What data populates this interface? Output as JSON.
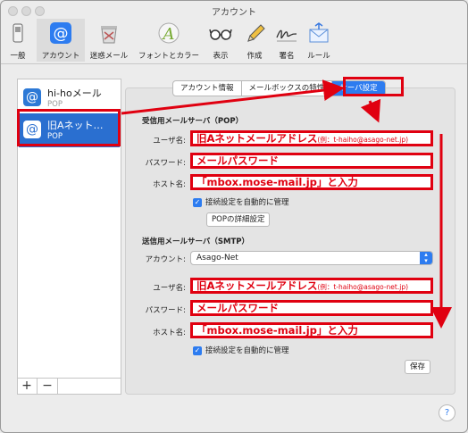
{
  "window": {
    "title": "アカウント"
  },
  "toolbar": {
    "items": [
      {
        "label": "一般",
        "icon": "switch-icon"
      },
      {
        "label": "アカウント",
        "icon": "at-sign-icon"
      },
      {
        "label": "迷惑メール",
        "icon": "junk-bin-icon"
      },
      {
        "label": "フォントとカラー",
        "icon": "font-color-icon"
      },
      {
        "label": "表示",
        "icon": "glasses-icon"
      },
      {
        "label": "作成",
        "icon": "pencil-icon"
      },
      {
        "label": "署名",
        "icon": "signature-icon"
      },
      {
        "label": "ルール",
        "icon": "envelope-rules-icon"
      }
    ],
    "selected": "アカウント"
  },
  "sidebar": {
    "accounts": [
      {
        "name": "hi-hoメール",
        "type": "POP"
      },
      {
        "name": "旧Aネット…",
        "type": "POP"
      }
    ],
    "add_label": "+",
    "remove_label": "−"
  },
  "tabs": [
    "アカウント情報",
    "メールボックスの特性",
    "サーバ設定"
  ],
  "incoming": {
    "heading": "受信用メールサーバ（POP）",
    "user_label": "ユーザ名:",
    "user_value": "旧Aネットメールアドレス",
    "user_note": "(例：t-haiho@asago-net.jp)",
    "password_label": "パスワード:",
    "password_value": "メールパスワード",
    "host_label": "ホスト名:",
    "host_value": "「mbox.mose-mail.jp」と入力",
    "auto_label": "接続設定を自動的に管理",
    "details_button": "POPの詳細設定"
  },
  "outgoing": {
    "heading": "送信用メールサーバ（SMTP）",
    "account_label": "アカウント:",
    "account_value": "Asago-Net",
    "user_label": "ユーザ名:",
    "user_value": "旧Aネットメールアドレス",
    "user_note": "(例：t-haiho@asago-net.jp)",
    "password_label": "パスワード:",
    "password_value": "メールパスワード",
    "host_label": "ホスト名:",
    "host_value": "「mbox.mose-mail.jp」と入力",
    "auto_label": "接続設定を自動的に管理"
  },
  "save_button": "保存",
  "help_label": "?",
  "colors": {
    "highlight": "#e00010",
    "accent": "#2d7cf0",
    "selection": "#2a6fd0"
  }
}
